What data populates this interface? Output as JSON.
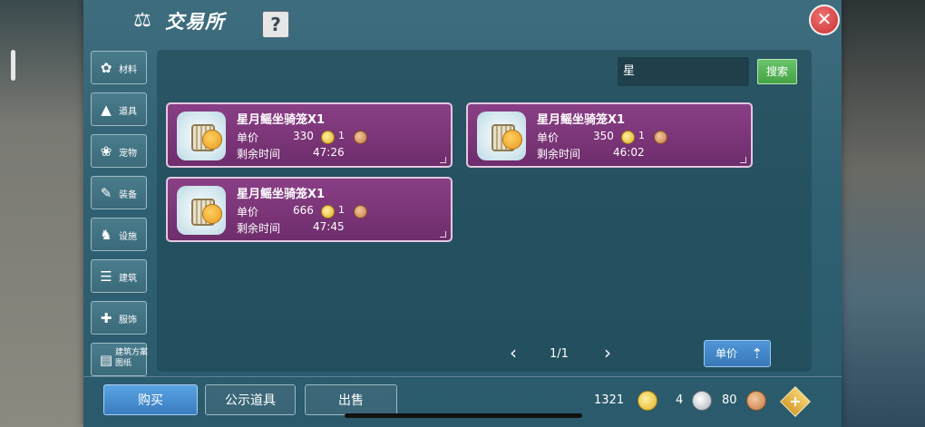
{
  "window": {
    "title": "交易所",
    "help_label": "?",
    "close_label": "✕"
  },
  "sidebar": {
    "items": [
      {
        "label": "材料",
        "icon": "materials-icon"
      },
      {
        "label": "道具",
        "icon": "items-icon"
      },
      {
        "label": "宠物",
        "icon": "paw-icon"
      },
      {
        "label": "装备",
        "icon": "equipment-icon"
      },
      {
        "label": "设施",
        "icon": "facility-icon"
      },
      {
        "label": "建筑",
        "icon": "building-icon"
      },
      {
        "label": "服饰",
        "icon": "clothing-icon"
      },
      {
        "label": "建筑方案图纸",
        "icon": "blueprint-icon"
      }
    ]
  },
  "search": {
    "value": "星",
    "button_label": "搜索"
  },
  "listings": [
    {
      "name": "星月鳐坐骑笼X1",
      "price_label": "单价",
      "price": "330",
      "qty": "1",
      "time_label": "剩余时间",
      "time_left": "47:26"
    },
    {
      "name": "星月鳐坐骑笼X1",
      "price_label": "单价",
      "price": "350",
      "qty": "1",
      "time_label": "剩余时间",
      "time_left": "46:02"
    },
    {
      "name": "星月鳐坐骑笼X1",
      "price_label": "单价",
      "price": "666",
      "qty": "1",
      "time_label": "剩余时间",
      "time_left": "47:45"
    }
  ],
  "pagination": {
    "prev": "‹",
    "text": "1/1",
    "next": "›"
  },
  "sort": {
    "label": "单价",
    "arrow": "⇡"
  },
  "tabs": {
    "buy": "购买",
    "public": "公示道具",
    "sell": "出售"
  },
  "currency": {
    "gold": "1321",
    "silver": "4",
    "bronze": "80",
    "add_label": "+"
  },
  "colors": {
    "card_bg": "#7a3577",
    "buy_tab": "#4a90d8",
    "search_button": "#55b355",
    "close_button": "#d84040"
  }
}
